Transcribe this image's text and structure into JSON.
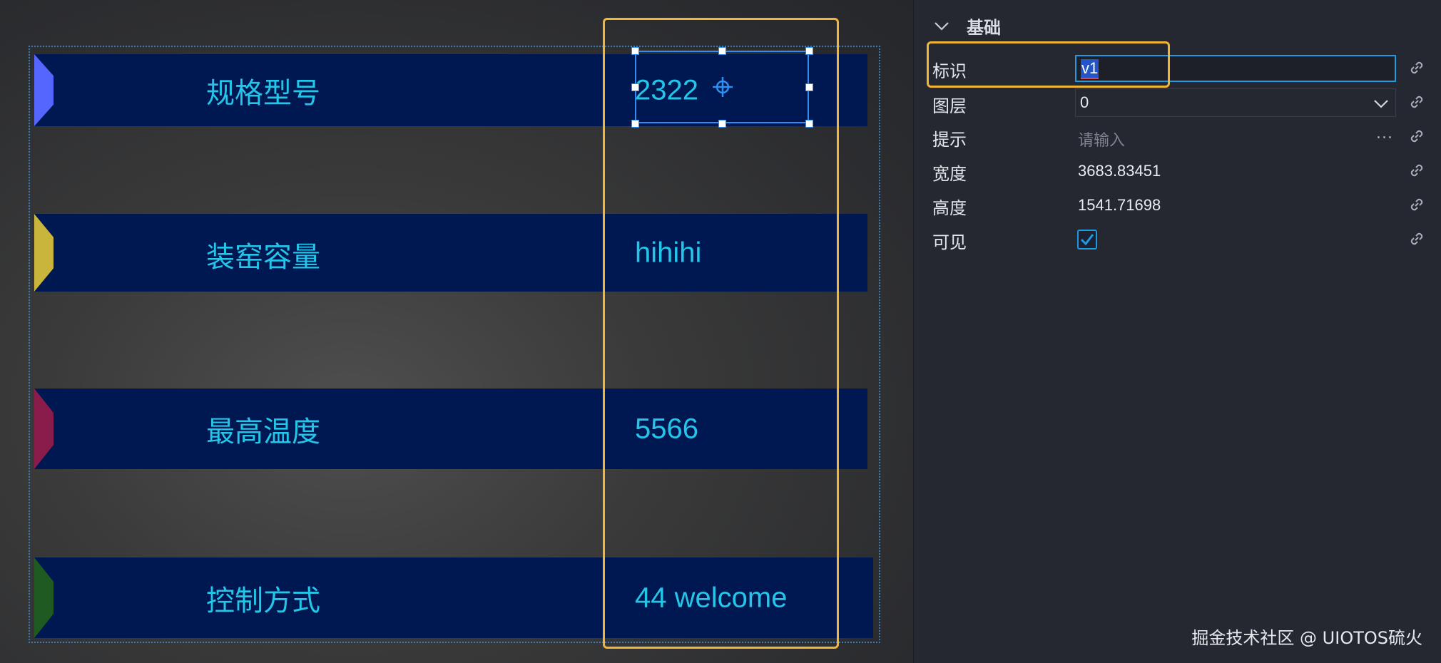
{
  "canvas": {
    "rows": [
      {
        "label": "规格型号",
        "value": "2322",
        "arrow_color": "#5566ff"
      },
      {
        "label": "装窑容量",
        "value": "hihihi",
        "arrow_color": "#c9b43c"
      },
      {
        "label": "最高温度",
        "value": "5566",
        "arrow_color": "#8a1c4b"
      },
      {
        "label": "控制方式",
        "value": "44 welcome",
        "arrow_color": "#1e5a22"
      }
    ],
    "row_background": "#001852",
    "text_color": "#23c6e8",
    "highlight_color": "#f0b63a",
    "selection_color": "#2f8ff0"
  },
  "panel": {
    "section_title": "基础",
    "id": {
      "label": "标识",
      "value": "v1"
    },
    "layer": {
      "label": "图层",
      "value": "0"
    },
    "hint": {
      "label": "提示",
      "placeholder": "请输入",
      "more": "..."
    },
    "width": {
      "label": "宽度",
      "value": "3683.83451"
    },
    "height": {
      "label": "高度",
      "value": "1541.71698"
    },
    "visible": {
      "label": "可见",
      "checked": true
    }
  },
  "watermark": "掘金技术社区 @ UIOTOS硫火"
}
